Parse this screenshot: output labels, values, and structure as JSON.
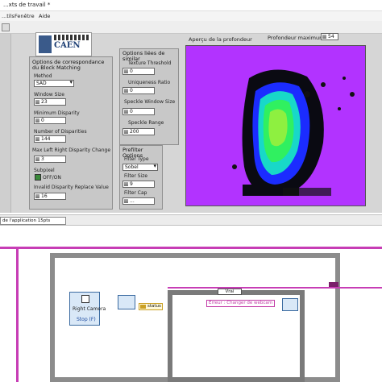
{
  "window": {
    "title": "...xts de travail *"
  },
  "menu": [
    "...tils",
    "Fenêtre",
    "Aide"
  ],
  "logo": {
    "text": "CAEN"
  },
  "block_matching": {
    "title": "Options de correspondance du Block Matching",
    "method_label": "Method",
    "method_value": "SAD",
    "window_size_label": "Window Size",
    "window_size_value": "23",
    "min_disp_label": "Minimum Disparity",
    "min_disp_value": "0",
    "num_disp_label": "Number of Disparities",
    "num_disp_value": "144",
    "max_lr_label": "Max Left Right Disparity Change",
    "max_lr_value": "3",
    "subpixel_label": "Subpixel",
    "subpixel_toggle": "OFF/ON",
    "invalid_label": "Invalid Disparity Replace Value",
    "invalid_value": "16"
  },
  "filter": {
    "title": "Options liées de similar",
    "texture_label": "Texture Threshold",
    "texture_value": "0",
    "uniq_label": "Uniqueness Ratio",
    "uniq_value": "0",
    "speckle_ws_label": "Speckle Window Size",
    "speckle_ws_value": "0",
    "speckle_range_label": "Speckle Range",
    "speckle_range_value": "200"
  },
  "prefilter": {
    "title": "Prefilter Options",
    "type_label": "Filter Type",
    "type_value": "Sobel",
    "size_label": "Filter Size",
    "size_value": "9",
    "cap_label": "Filter Cap",
    "cap_value": "..."
  },
  "depth_preview": {
    "label": "Aperçu de la profondeur",
    "max_depth_label": "Profondeur maximum",
    "max_depth_value": "54"
  },
  "block_diagram": {
    "font_select": "de l'application 15pts",
    "camera_label": "Right Camera",
    "stop_label": "Stop (F)",
    "status_label": "status",
    "case_label": "Vrai",
    "error_text": "Erreur : Changer de webcam"
  },
  "colors": {
    "panel_bg": "#d6d6d6",
    "image_bg": "#b233ff",
    "wire": "#c73db5"
  }
}
